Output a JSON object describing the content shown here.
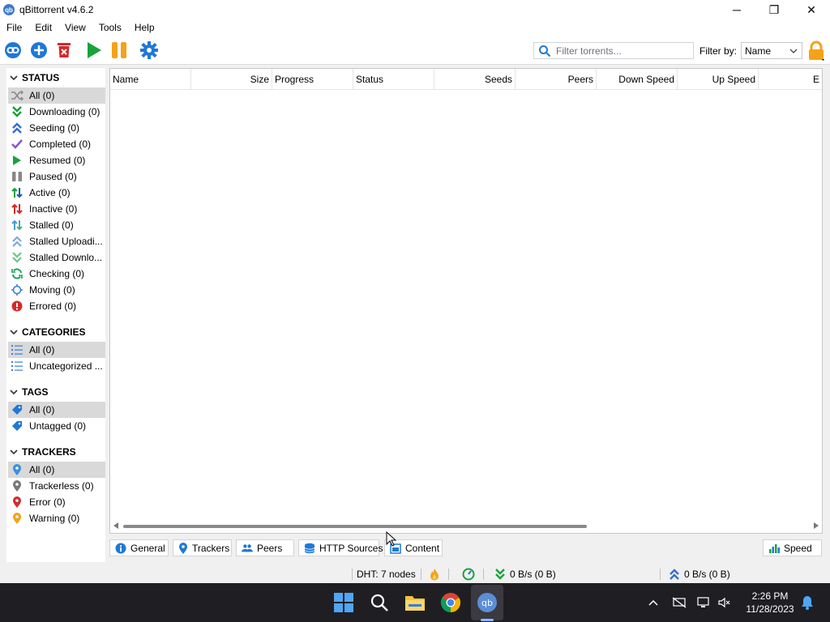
{
  "window": {
    "title": "qBittorrent v4.6.2",
    "logo_text": "qb",
    "minimize": "─",
    "maximize": "❐",
    "close": "✕"
  },
  "menu": [
    "File",
    "Edit",
    "View",
    "Tools",
    "Help"
  ],
  "toolbar": {
    "buttons": [
      "add-link",
      "add-torrent",
      "delete",
      "resume",
      "pause",
      "options"
    ],
    "filter_placeholder": "Filter torrents...",
    "filter_by_label": "Filter by:",
    "filter_by_value": "Name"
  },
  "sidebar": {
    "status": {
      "header": "STATUS",
      "items": [
        {
          "label": "All (0)",
          "icon": "shuffle-icon"
        },
        {
          "label": "Downloading (0)",
          "icon": "double-chevron-down-icon"
        },
        {
          "label": "Seeding (0)",
          "icon": "double-chevron-up-icon"
        },
        {
          "label": "Completed (0)",
          "icon": "checkmark-icon"
        },
        {
          "label": "Resumed (0)",
          "icon": "play-icon"
        },
        {
          "label": "Paused (0)",
          "icon": "pause-icon"
        },
        {
          "label": "Active (0)",
          "icon": "arrows-updown-icon"
        },
        {
          "label": "Inactive (0)",
          "icon": "arrows-updown-red-icon"
        },
        {
          "label": "Stalled (0)",
          "icon": "arrows-updown-blue-icon"
        },
        {
          "label": "Stalled Uploadi...",
          "icon": "double-chevron-up-light-icon"
        },
        {
          "label": "Stalled Downlo...",
          "icon": "double-chevron-down-light-icon"
        },
        {
          "label": "Checking (0)",
          "icon": "refresh-icon"
        },
        {
          "label": "Moving (0)",
          "icon": "crosshair-icon"
        },
        {
          "label": "Errored (0)",
          "icon": "error-icon"
        }
      ]
    },
    "categories": {
      "header": "CATEGORIES",
      "items": [
        {
          "label": "All (0)",
          "icon": "list-icon"
        },
        {
          "label": "Uncategorized ...",
          "icon": "list-icon"
        }
      ]
    },
    "tags": {
      "header": "TAGS",
      "items": [
        {
          "label": "All (0)",
          "icon": "tag-icon"
        },
        {
          "label": "Untagged (0)",
          "icon": "tag-icon"
        }
      ]
    },
    "trackers": {
      "header": "TRACKERS",
      "items": [
        {
          "label": "All (0)",
          "icon": "pin-blue-icon"
        },
        {
          "label": "Trackerless (0)",
          "icon": "pin-gray-icon"
        },
        {
          "label": "Error (0)",
          "icon": "pin-red-icon"
        },
        {
          "label": "Warning (0)",
          "icon": "pin-orange-icon"
        }
      ]
    }
  },
  "columns": [
    "Name",
    "Size",
    "Progress",
    "Status",
    "Seeds",
    "Peers",
    "Down Speed",
    "Up Speed",
    "E"
  ],
  "bottom_tabs": [
    "General",
    "Trackers",
    "Peers",
    "HTTP Sources",
    "Content"
  ],
  "speed_tab": "Speed",
  "statusbar": {
    "dht": "DHT: 7 nodes",
    "download": "0 B/s (0 B)",
    "upload": "0 B/s (0 B)"
  },
  "taskbar": {
    "time": "2:26 PM",
    "date": "11/28/2023"
  },
  "colors": {
    "accent_blue": "#1e78d7",
    "green": "#18a33a",
    "orange": "#f4a21a",
    "red": "#d42a2a",
    "selected_bg": "#d9d9d9"
  }
}
